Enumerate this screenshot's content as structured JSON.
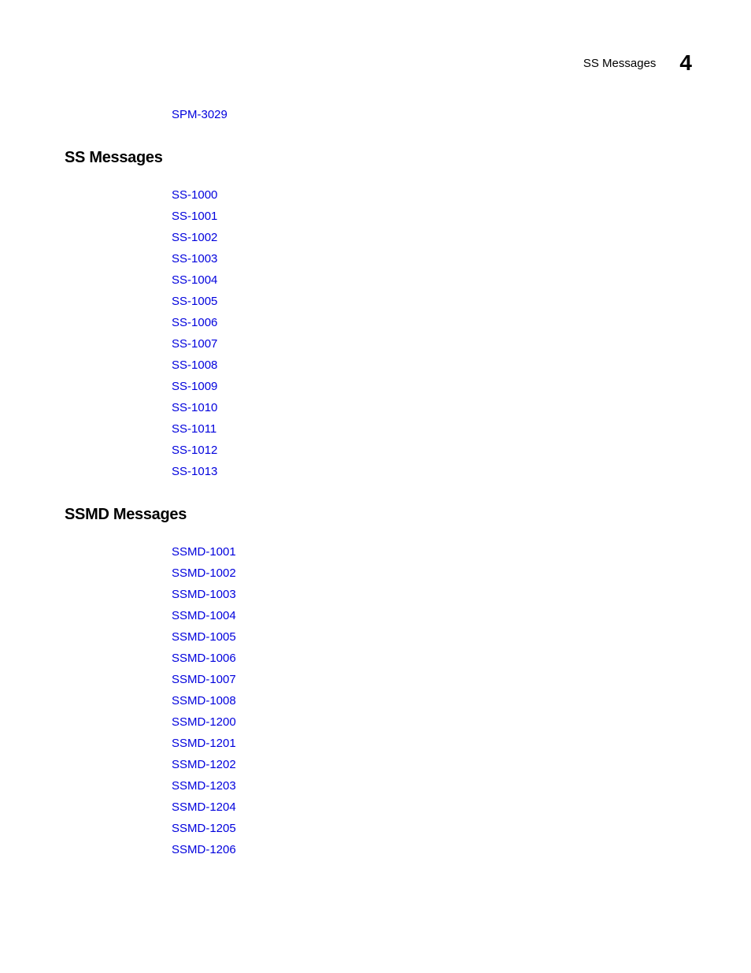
{
  "header": {
    "title": "SS Messages",
    "chapter": "4"
  },
  "pre_links": [
    "SPM-3029"
  ],
  "sections": [
    {
      "heading": "SS Messages",
      "links": [
        "SS-1000",
        "SS-1001",
        "SS-1002",
        "SS-1003",
        "SS-1004",
        "SS-1005",
        "SS-1006",
        "SS-1007",
        "SS-1008",
        "SS-1009",
        "SS-1010",
        "SS-1011",
        "SS-1012",
        "SS-1013"
      ]
    },
    {
      "heading": "SSMD Messages",
      "links": [
        "SSMD-1001",
        "SSMD-1002",
        "SSMD-1003",
        "SSMD-1004",
        "SSMD-1005",
        "SSMD-1006",
        "SSMD-1007",
        "SSMD-1008",
        "SSMD-1200",
        "SSMD-1201",
        "SSMD-1202",
        "SSMD-1203",
        "SSMD-1204",
        "SSMD-1205",
        "SSMD-1206"
      ]
    }
  ]
}
